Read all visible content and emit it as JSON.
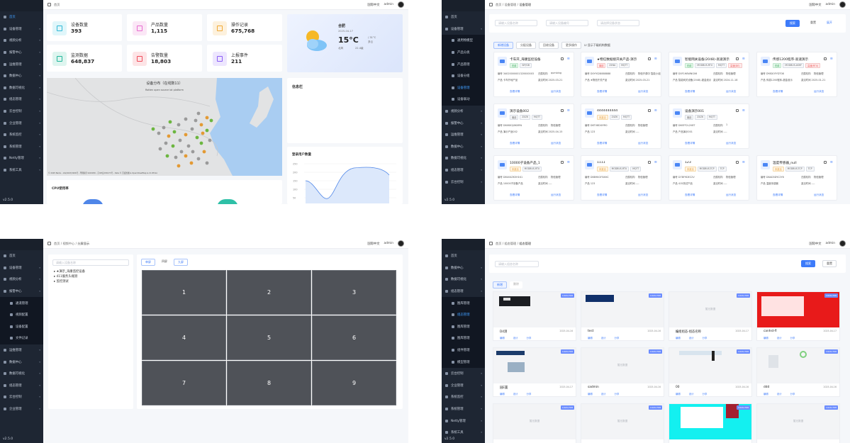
{
  "common": {
    "lang": "国际中文",
    "user": "admin",
    "version": "v2.5.0",
    "home": "首页"
  },
  "panel1": {
    "sidebar": [
      {
        "label": "首页",
        "active": true
      },
      {
        "label": "设备管理"
      },
      {
        "label": "视频分析"
      },
      {
        "label": "报警中心"
      },
      {
        "label": "运维管理"
      },
      {
        "label": "数据中心"
      },
      {
        "label": "数据可视化"
      },
      {
        "label": "组态管理"
      },
      {
        "label": "云台控制"
      },
      {
        "label": "企业管理"
      },
      {
        "label": "系统监控"
      },
      {
        "label": "系统管理"
      },
      {
        "label": "Netty管理"
      },
      {
        "label": "系统工具"
      }
    ],
    "breadcrumb": "首页",
    "stats": [
      {
        "label": "设备数量",
        "value": "393",
        "color": "#2fb8d6",
        "bg": "#e0f6fa"
      },
      {
        "label": "产品数量",
        "value": "1,115",
        "color": "#e86bd0",
        "bg": "#fbe7f6"
      },
      {
        "label": "操作记录",
        "value": "675,768",
        "color": "#f1a934",
        "bg": "#fdf1dd"
      },
      {
        "label": "监测数据",
        "value": "648,837",
        "color": "#20b79a",
        "bg": "#def5ef"
      },
      {
        "label": "告警数量",
        "value": "18,803",
        "color": "#ef4b5a",
        "bg": "#fde4e6"
      },
      {
        "label": "上报事件",
        "value": "211",
        "color": "#8b5cf6",
        "bg": "#ede6fe"
      }
    ],
    "weather": {
      "city": "合肥",
      "date": "2025-04-17",
      "temp": "15°C",
      "range": "/ 31°C",
      "cond": "多云",
      "wind": "北风",
      "level": "22.4级",
      "hum": "湿度"
    },
    "map": {
      "title": "设备分布（在线数11）",
      "subtitle": "Rotten open source iot platform",
      "attribution": "© 2025 Baidu - GS(2023)3206号 - 甲测资字1100930 - 京ICP证030173号 - Data © 百度智图 & OpenStreetMap & CC-BY-SA",
      "scale": "500 公里"
    },
    "info": {
      "title": "信息栏"
    },
    "cpu": {
      "title": "CPU使用率"
    },
    "login": {
      "title": "登录用户数量",
      "yticks": [
        "250",
        "200",
        "150",
        "100",
        "50"
      ]
    }
  },
  "panel2": {
    "sidebar": [
      {
        "label": "首页"
      },
      {
        "label": "设备管理",
        "open": true
      },
      {
        "label": "通用物模型",
        "sub": true
      },
      {
        "label": "产品分类",
        "sub": true
      },
      {
        "label": "产品管理",
        "sub": true
      },
      {
        "label": "设备分组",
        "sub": true
      },
      {
        "label": "设备管理",
        "sub": true,
        "active": true
      },
      {
        "label": "设备联动",
        "sub": true
      },
      {
        "label": "视频分析"
      },
      {
        "label": "报警中心"
      },
      {
        "label": "运维管理"
      },
      {
        "label": "数据中心"
      },
      {
        "label": "数据可视化"
      },
      {
        "label": "组态管理"
      },
      {
        "label": "云台控制"
      }
    ],
    "breadcrumb": [
      "首页",
      "设备管理",
      "设备管理"
    ],
    "filters": [
      "请输入设备名称",
      "请输入设备编号",
      "请选择设备状态"
    ],
    "search": "搜索",
    "reset": "重置",
    "expand": "展开",
    "actions": [
      "新增设备",
      "分配设备",
      "回收设备",
      "更多操作"
    ],
    "checkbox": "显示下级机构数据",
    "devices": [
      {
        "name": "卡车开_海康监控设备",
        "tags": [
          [
            "在线",
            "g"
          ],
          [
            "SIP/GB"
          ]
        ],
        "no": "编号 34020000001320000003",
        "auth": "归属机构",
        "authv": "qumbing",
        "prod": "产品 卡车开地产品",
        "time": "激活时间 2025-03-21"
      },
      {
        "name": "★物信数据接开关产品-演示",
        "tags": [
          [
            "离线",
            "r"
          ],
          [
            "Z4NA"
          ],
          [
            "MQTT"
          ]
        ],
        "no": "编号 D0Y9328888888",
        "auth": "归属机构",
        "authv": "物信开源中 智能小组",
        "prod": "产品 ★物信开关产品",
        "time": "激活时间 2025-03-21"
      },
      {
        "name": "智能网关设备(2048)-高速演示",
        "tags": [
          [
            "在线",
            "g"
          ],
          [
            "MODBUS-RTU"
          ],
          [
            "MQTT"
          ],
          [
            "高速(DE)",
            "r"
          ]
        ],
        "no": "编号 D0F1H8WNG06",
        "auth": "归属机构",
        "authv": "物信管理",
        "prod": "产品 智能网关设备(2048)-超金液示",
        "time": "激活时间 2024-11-18"
      },
      {
        "name": "传感1200程序-高速演示",
        "tags": [
          [
            "在线",
            "g"
          ],
          [
            "MODBUS-ASHF"
          ],
          [
            "高速(RTU)",
            "r"
          ]
        ],
        "no": "编号 DY8DOFYDT08",
        "auth": "归属机构",
        "authv": "物信管理",
        "prod": "产品 传感1200程序-超金液示",
        "time": "激活时间 2025-01-21"
      },
      {
        "name": "演示设备002",
        "tags": [
          [
            "离线"
          ],
          [
            "Z4Z6"
          ],
          [
            "MQTT"
          ]
        ],
        "no": "编号 D6XKK2J6K0RN",
        "auth": "归属机构",
        "authv": "物信管理",
        "prod": "产品 演示产品002",
        "time": "激活时间 2025-04-15"
      },
      {
        "name": "4444444444",
        "tags": [
          [
            "未激活",
            "o"
          ],
          [
            "Z4Z6"
          ],
          [
            "MQTT"
          ]
        ],
        "no": "编号 D6TV8DI0YR0",
        "auth": "归属机构",
        "authv": "物信管理",
        "prod": "产品 123",
        "time": "激活时间 ----"
      },
      {
        "name": "设备演示001",
        "tags": [
          [
            "离线"
          ],
          [
            "Z4Z6"
          ],
          [
            "MQTT"
          ]
        ],
        "no": "编号 D6SFF2L2V8T",
        "auth": "归属机构",
        "authv": "1",
        "prod": "产品 产品演示001",
        "time": "激活时间 ----"
      },
      {
        "name": "10000子设备产品_1",
        "tags": [
          [
            "未激活",
            "o"
          ],
          [
            "MODBUS-RTU"
          ]
        ],
        "no": "编号 D6U04ZK5H1K1",
        "auth": "归属机构",
        "authv": "物信管理",
        "prod": "产品 10000子设备产品",
        "time": "激活时间 ----"
      },
      {
        "name": "1111",
        "tags": [
          [
            "未激活",
            "o"
          ],
          [
            "MODBUS-RTU"
          ],
          [
            "MQTT"
          ]
        ],
        "no": "编号 D6B9KGY5XIKC",
        "auth": "归属机构",
        "authv": "物信管理",
        "prod": "产品 123",
        "time": "激活时间 ----"
      },
      {
        "name": "123",
        "tags": [
          [
            "未激活",
            "o"
          ],
          [
            "MODBUS-TCP"
          ],
          [
            "TCP"
          ]
        ],
        "no": "编号 D7BF9DEC2V",
        "auth": "归属机构",
        "authv": "物信管理",
        "prod": "产品 415测试产品",
        "time": "激活时间 ----"
      },
      {
        "name": "温度传感器_null",
        "tags": [
          [
            "未激活",
            "o"
          ],
          [
            "MODBUS-TCP"
          ],
          [
            "TCP"
          ]
        ],
        "no": "编号 D6AD3DYC2Y6",
        "auth": "归属机构",
        "authv": "物信管理",
        "prod": "产品 温度传感器",
        "time": "激活时间 ----"
      }
    ],
    "detail": "查看详情",
    "run": "运行状态"
  },
  "panel3": {
    "sidebar": [
      {
        "label": "首页"
      },
      {
        "label": "设备管理"
      },
      {
        "label": "视频分析"
      },
      {
        "label": "报警中心",
        "open": true
      },
      {
        "label": "通道管理",
        "sub": true
      },
      {
        "label": "视频配置",
        "sub": true
      },
      {
        "label": "设备配置",
        "sub": true
      },
      {
        "label": "文件记录",
        "sub": true
      },
      {
        "label": "运维管理"
      },
      {
        "label": "数据中心"
      },
      {
        "label": "数据可视化"
      },
      {
        "label": "组态管理"
      },
      {
        "label": "云台控制"
      },
      {
        "label": "企业管理"
      }
    ],
    "breadcrumb": [
      "首页",
      "视频中心",
      "分屏显示"
    ],
    "tree_placeholder": "请输入设备名称",
    "tree": [
      "★演示_海康监控设备",
      "411服务头端测",
      "监控测试"
    ],
    "views": [
      "单屏",
      "四屏",
      "九屏"
    ],
    "cells": [
      "1",
      "2",
      "3",
      "4",
      "5",
      "6",
      "7",
      "8",
      "9"
    ]
  },
  "panel4": {
    "sidebar": [
      {
        "label": "首页"
      },
      {
        "label": "数据中心"
      },
      {
        "label": "数据可视化"
      },
      {
        "label": "组态管理",
        "open": true
      },
      {
        "label": "图库管理",
        "sub": true
      },
      {
        "label": "组态管理",
        "sub": true,
        "active": true
      },
      {
        "label": "图库管理",
        "sub": true
      },
      {
        "label": "图库管理",
        "sub": true
      },
      {
        "label": "组件管理",
        "sub": true
      },
      {
        "label": "模型管理",
        "sub": true
      },
      {
        "label": "云台控制"
      },
      {
        "label": "企业管理"
      },
      {
        "label": "系统监控"
      },
      {
        "label": "系统管理"
      },
      {
        "label": "Netty管理"
      },
      {
        "label": "系统工具"
      }
    ],
    "breadcrumb": [
      "首页",
      "组态管理",
      "组态管理"
    ],
    "filter": "请输入组态名称",
    "search": "搜索",
    "reset": "重置",
    "add": "新增",
    "del": "删除",
    "badge": "1024x768",
    "nodata": "暂无数据",
    "cards": [
      {
        "name": "D4测",
        "date": "2025-04-16",
        "thumb": "dark"
      },
      {
        "name": "test",
        "date": "2025-04-16",
        "thumb": "map"
      },
      {
        "name": "编组组态-组态名称",
        "date": "2025-04-17",
        "thumb": "empty"
      },
      {
        "name": "canhst-fl",
        "date": "2025-04-17",
        "thumb": "red"
      },
      {
        "name": "园E置",
        "date": "2025-04-17",
        "thumb": "mix"
      },
      {
        "name": "sadmin",
        "date": "2025-04-16",
        "thumb": "none"
      },
      {
        "name": "00",
        "date": "2025-04-16",
        "thumb": "mix2"
      },
      {
        "name": "ddd",
        "date": "2025-04-16",
        "thumb": "mix3"
      },
      {
        "name": "",
        "date": "",
        "thumb": "none"
      },
      {
        "name": "",
        "date": "",
        "thumb": "none"
      },
      {
        "name": "",
        "date": "",
        "thumb": "cyan"
      },
      {
        "name": "",
        "date": "",
        "thumb": "none"
      }
    ],
    "actions": [
      "编辑",
      "设计",
      "分享"
    ]
  }
}
